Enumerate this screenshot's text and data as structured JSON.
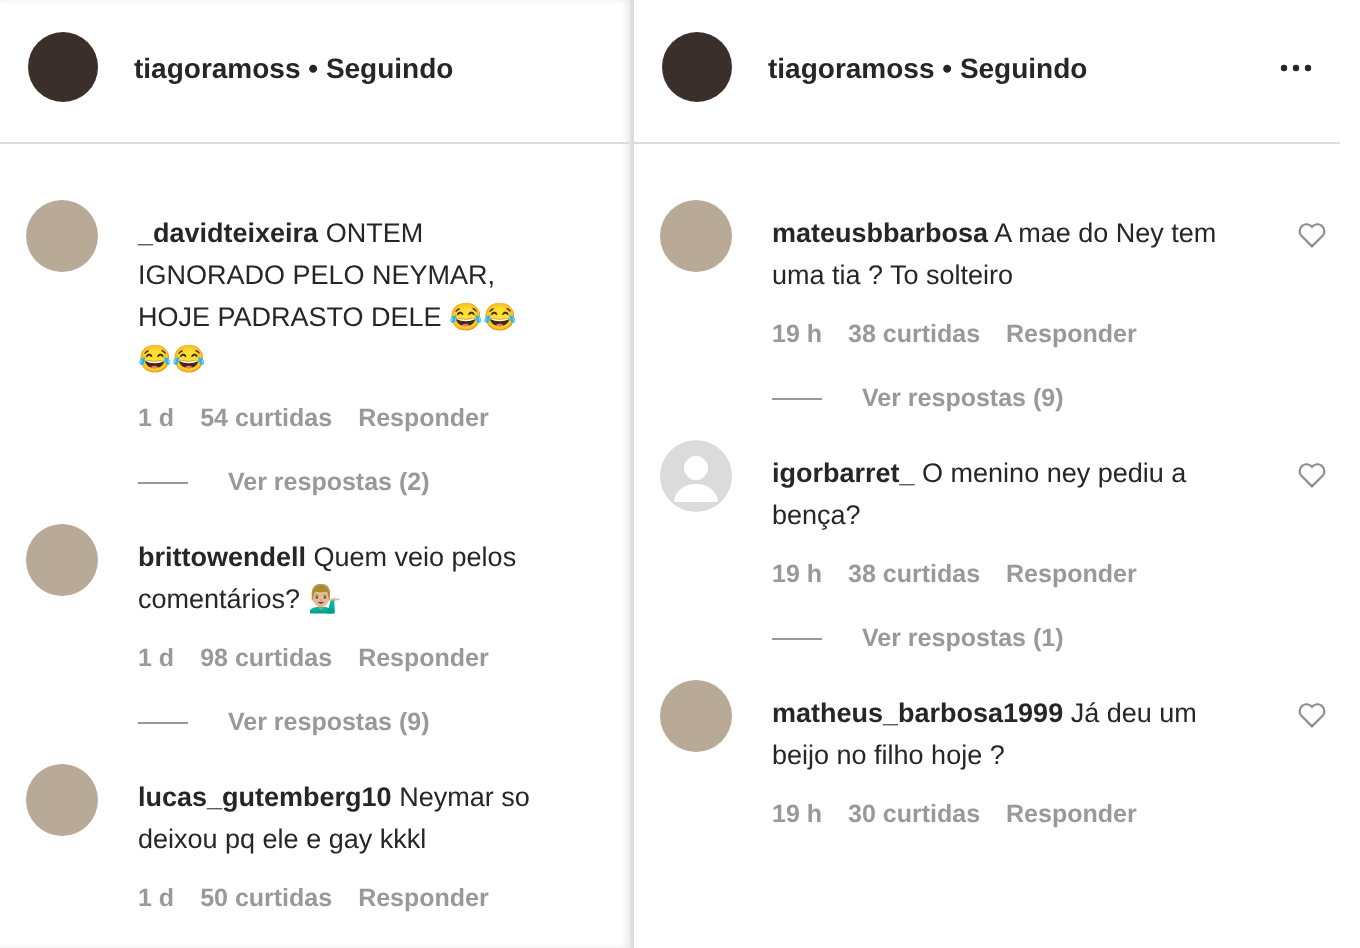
{
  "panels": [
    {
      "header": {
        "username": "tiagoramoss",
        "separator": "•",
        "status": "Seguindo",
        "more_menu": false
      },
      "comments": [
        {
          "kind": "photo",
          "user": "_davidteixeira",
          "text": "ONTEM IGNORADO PELO NEYMAR, HOJE PADRASTO DELE 😂😂😂😂",
          "time": "1 d",
          "likes": "54 curtidas",
          "reply": "Responder",
          "replies": "Ver respostas (2)",
          "heart": false
        },
        {
          "kind": "photo",
          "user": "brittowendell",
          "text": "Quem veio pelos comentários? 💁🏼‍♂️",
          "time": "1 d",
          "likes": "98 curtidas",
          "reply": "Responder",
          "replies": "Ver respostas (9)",
          "heart": false
        },
        {
          "kind": "photo",
          "user": "lucas_gutemberg10",
          "text": "Neymar so deixou pq ele e gay kkkl",
          "time": "1 d",
          "likes": "50 curtidas",
          "reply": "Responder",
          "heart": false
        }
      ]
    },
    {
      "header": {
        "username": "tiagoramoss",
        "separator": "•",
        "status": "Seguindo",
        "more_menu": true
      },
      "comments": [
        {
          "kind": "photo",
          "user": "mateusbbarbosa",
          "text": "A mae do Ney tem uma tia ? To solteiro",
          "time": "19 h",
          "likes": "38 curtidas",
          "reply": "Responder",
          "replies": "Ver respostas (9)",
          "heart": true
        },
        {
          "kind": "default",
          "user": "igorbarret_",
          "text": "O menino ney pediu a bença?",
          "time": "19 h",
          "likes": "38 curtidas",
          "reply": "Responder",
          "replies": "Ver respostas (1)",
          "heart": true
        },
        {
          "kind": "photo",
          "user": "matheus_barbosa1999",
          "text": "Já deu um beijo no filho hoje ?",
          "time": "19 h",
          "likes": "30 curtidas",
          "reply": "Responder",
          "heart": true
        }
      ]
    }
  ]
}
